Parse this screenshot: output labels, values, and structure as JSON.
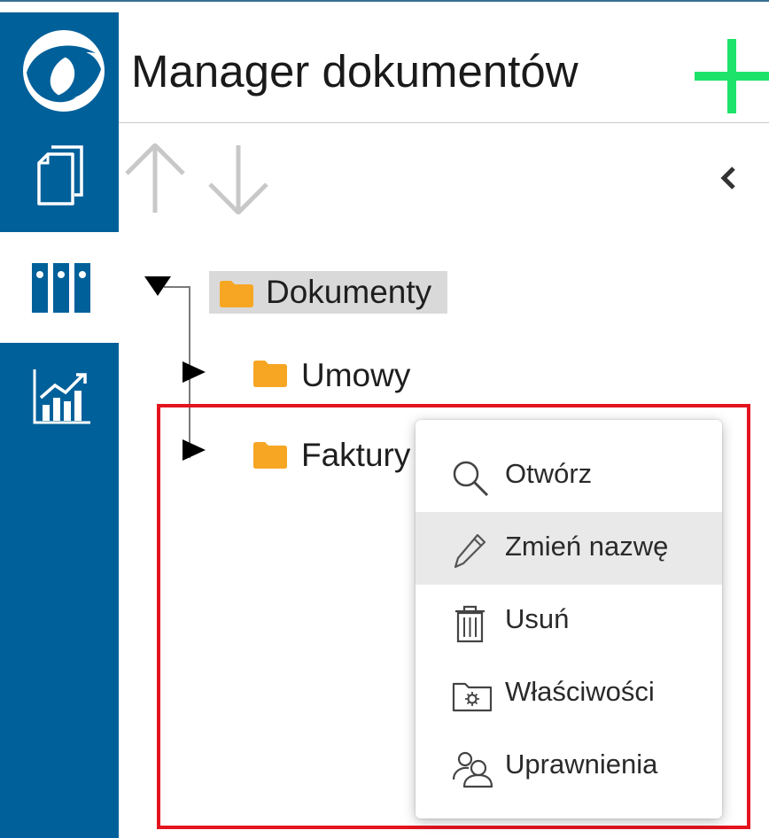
{
  "header": {
    "title": "Manager dokumentów"
  },
  "tree": {
    "root": {
      "label": "Dokumenty"
    },
    "children": [
      {
        "label": "Umowy"
      },
      {
        "label": "Faktury"
      }
    ]
  },
  "context_menu": {
    "items": [
      {
        "label": "Otwórz",
        "icon": "search-icon"
      },
      {
        "label": "Zmień nazwę",
        "icon": "pencil-icon"
      },
      {
        "label": "Usuń",
        "icon": "trash-icon"
      },
      {
        "label": "Właściwości",
        "icon": "folder-settings-icon"
      },
      {
        "label": "Uprawnienia",
        "icon": "users-icon"
      }
    ],
    "highlighted_index": 1
  },
  "colors": {
    "sidebar": "#00609a",
    "add_button": "#1ee36a",
    "folder": "#f6a623",
    "focus_frame": "#e3141e",
    "menu_highlight": "#e9e9e9"
  }
}
